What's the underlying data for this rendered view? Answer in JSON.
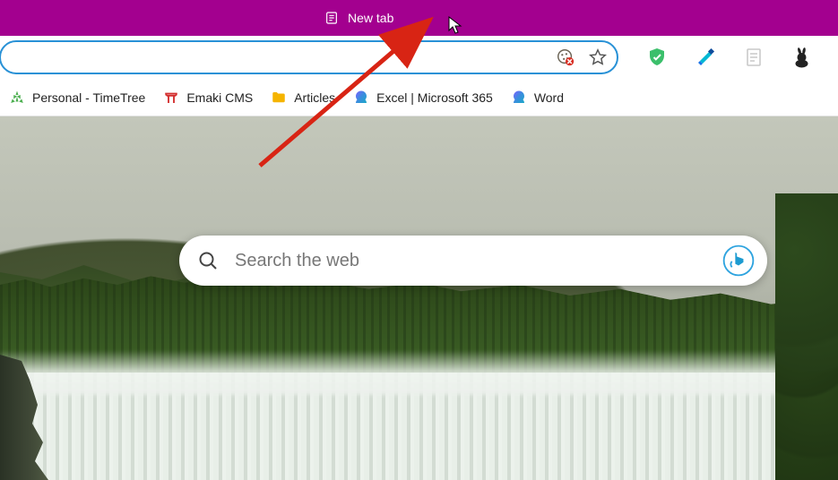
{
  "titlebar": {
    "tab_label": "New tab",
    "color": "#a3008f"
  },
  "addressbar": {
    "value": "",
    "cookie_icon": "cookie-blocked-icon",
    "star_icon": "favorite-icon"
  },
  "toolbar": {
    "shield": "shield-check-icon",
    "highlighter": "highlighter-icon",
    "page": "page-disabled-icon",
    "rabbit": "rabbit-icon"
  },
  "bookmarks": [
    {
      "label": "Personal - TimeTree",
      "icon": "timetree-icon",
      "color": "#4caf50"
    },
    {
      "label": "Emaki CMS",
      "icon": "torii-icon",
      "color": "#d32f2f"
    },
    {
      "label": "Articles",
      "icon": "folder-icon",
      "color": "#f5b400"
    },
    {
      "label": "Excel | Microsoft 365",
      "icon": "m365-icon",
      "color": "#3a8dde"
    },
    {
      "label": "Word",
      "icon": "m365-icon",
      "color": "#3a8dde"
    }
  ],
  "search": {
    "placeholder": "Search the web",
    "bing_icon": "bing-chat-icon"
  }
}
